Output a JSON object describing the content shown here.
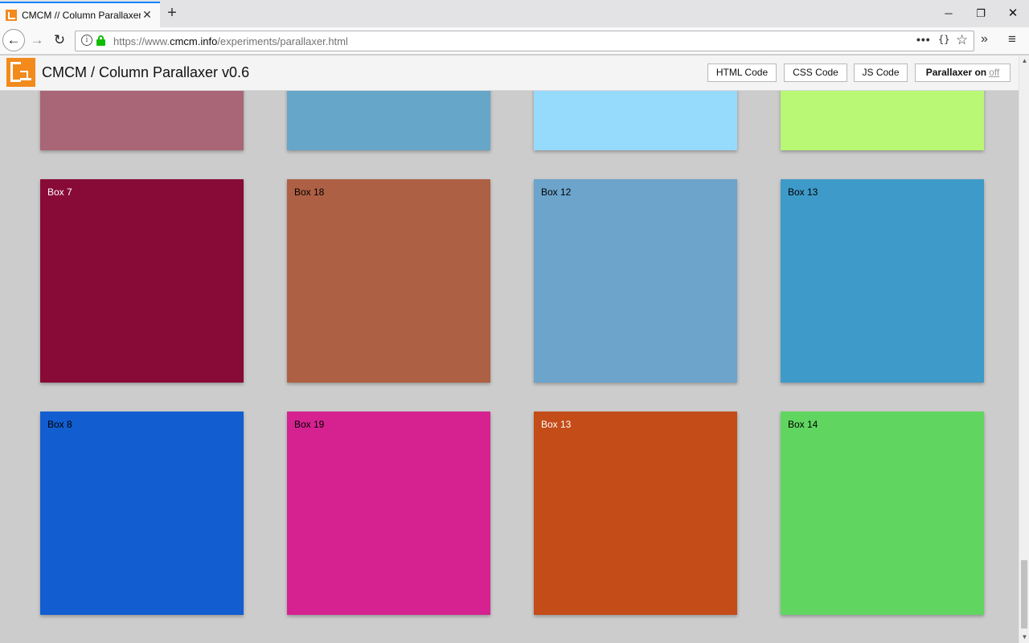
{
  "browser": {
    "tab_title": "CMCM // Column Parallaxer // CMCM",
    "tab_close_glyph": "✕",
    "new_tab_glyph": "+",
    "window_minimize_glyph": "─",
    "window_maximize_glyph": "❐",
    "window_close_glyph": "✕",
    "back_glyph": "←",
    "forward_glyph": "→",
    "reload_glyph": "↻",
    "url_prefix": "https://www.",
    "url_domain": "cmcm.info",
    "url_path": "/experiments/parallaxer.html",
    "info_glyph": "i",
    "page_actions_glyph": "•••",
    "json_glyph": "{}",
    "bookmark_glyph": "☆",
    "overflow_glyph": "»",
    "menu_glyph": "≡",
    "accent_color": "#0a84ff"
  },
  "site": {
    "title": "CMCM / Column Parallaxer v0.6",
    "brand_color": "#f28a1c",
    "buttons": {
      "html": "HTML Code",
      "css": "CSS Code",
      "js": "JS Code",
      "toggle_on": "Parallaxer on",
      "toggle_off": "off"
    }
  },
  "boxes": {
    "row0": [
      {
        "label": "",
        "color": "#a86676",
        "text_color": "#ffffff"
      },
      {
        "label": "",
        "color": "#66a6c8",
        "text_color": "#000000"
      },
      {
        "label": "",
        "color": "#96dafc",
        "text_color": "#000000"
      },
      {
        "label": "",
        "color": "#b8f874",
        "text_color": "#000000"
      }
    ],
    "row1": [
      {
        "label": "Box 7",
        "color": "#880a36",
        "text_color": "#ffffff"
      },
      {
        "label": "Box 18",
        "color": "#ae6044",
        "text_color": "#000000"
      },
      {
        "label": "Box 12",
        "color": "#6ca4cc",
        "text_color": "#000000"
      },
      {
        "label": "Box 13",
        "color": "#3e9ac8",
        "text_color": "#000000"
      }
    ],
    "row2": [
      {
        "label": "Box 8",
        "color": "#125ed0",
        "text_color": "#000000"
      },
      {
        "label": "Box 19",
        "color": "#d62290",
        "text_color": "#000000"
      },
      {
        "label": "Box 13",
        "color": "#c44c18",
        "text_color": "#ffffff"
      },
      {
        "label": "Box 14",
        "color": "#60d660",
        "text_color": "#000000"
      }
    ]
  },
  "scrollbar": {
    "up_glyph": "▲",
    "down_glyph": "▼"
  }
}
